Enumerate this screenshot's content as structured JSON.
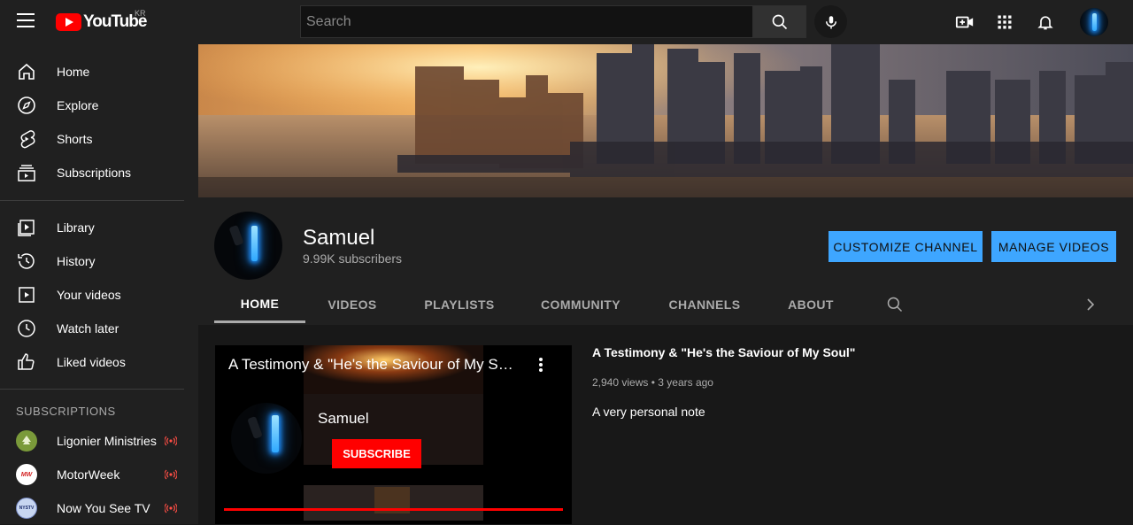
{
  "header": {
    "logo_text": "YouTube",
    "country_code": "KR",
    "search_placeholder": "Search",
    "icons": [
      "menu-icon",
      "search-icon",
      "microphone-icon",
      "create-video-icon",
      "apps-grid-icon",
      "bell-icon",
      "account-avatar"
    ]
  },
  "sidebar": {
    "primary": [
      {
        "label": "Home",
        "icon": "home-icon"
      },
      {
        "label": "Explore",
        "icon": "compass-icon"
      },
      {
        "label": "Shorts",
        "icon": "shorts-icon"
      },
      {
        "label": "Subscriptions",
        "icon": "subscriptions-icon"
      }
    ],
    "secondary": [
      {
        "label": "Library",
        "icon": "library-icon"
      },
      {
        "label": "History",
        "icon": "history-icon"
      },
      {
        "label": "Your videos",
        "icon": "your-videos-icon"
      },
      {
        "label": "Watch later",
        "icon": "clock-icon"
      },
      {
        "label": "Liked videos",
        "icon": "thumbs-up-icon"
      }
    ],
    "subscriptions_heading": "SUBSCRIPTIONS",
    "subscriptions": [
      {
        "label": "Ligonier Ministries",
        "avatar_color": "#7a9a3a",
        "live": true
      },
      {
        "label": "MotorWeek",
        "avatar_text": "MW",
        "avatar_color": "#ffffff",
        "live": true
      },
      {
        "label": "Now You See TV",
        "avatar_text": "NYSTV",
        "avatar_color": "#c8d6f0",
        "live": true
      }
    ]
  },
  "channel": {
    "name": "Samuel",
    "subscribers": "9.99K subscribers",
    "customize_label": "CUSTOMIZE CHANNEL",
    "manage_label": "MANAGE VIDEOS",
    "tabs": [
      "HOME",
      "VIDEOS",
      "PLAYLISTS",
      "COMMUNITY",
      "CHANNELS",
      "ABOUT"
    ],
    "active_tab": "HOME"
  },
  "featured": {
    "player_title": "A Testimony & \"He's the Saviour of My Soul\"",
    "player_channel": "Samuel",
    "subscribe_label": "SUBSCRIBE",
    "title": "A Testimony & \"He's the Saviour of My Soul\"",
    "views": "2,940 views",
    "separator": "•",
    "age": "3 years ago",
    "description": "A very personal note"
  },
  "colors": {
    "accent_blue": "#3ea6ff",
    "brand_red": "#ff0000",
    "background": "#181818",
    "surface": "#202020"
  }
}
